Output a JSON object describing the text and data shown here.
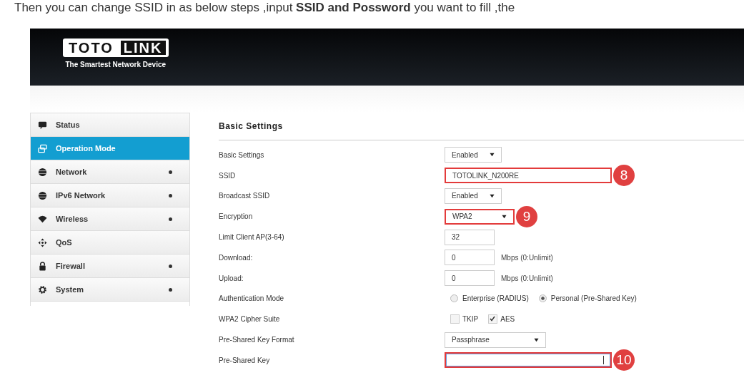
{
  "document_text": "Then you can change SSID in as below steps ,input **SSID and Possword** you want to fill ,the",
  "header": {
    "logo_left": "TOTO",
    "logo_right": "LINK",
    "tagline": "The Smartest Network Device"
  },
  "sidebar": {
    "items": [
      {
        "label": "Status",
        "kind": "chat",
        "selected": false,
        "expandable": false
      },
      {
        "label": "Operation Mode",
        "kind": "windows",
        "selected": true,
        "expandable": false
      },
      {
        "label": "Network",
        "kind": "globe",
        "selected": false,
        "expandable": true
      },
      {
        "label": "IPv6 Network",
        "kind": "globe",
        "selected": false,
        "expandable": true
      },
      {
        "label": "Wireless",
        "kind": "wifi",
        "selected": false,
        "expandable": true
      },
      {
        "label": "QoS",
        "kind": "arrows",
        "selected": false,
        "expandable": false
      },
      {
        "label": "Firewall",
        "kind": "lock",
        "selected": false,
        "expandable": true
      },
      {
        "label": "System",
        "kind": "gear",
        "selected": false,
        "expandable": true
      }
    ]
  },
  "section_title": "Basic Settings",
  "rows": [
    {
      "label": "Basic Settings",
      "kind": "select",
      "value": "Enabled",
      "highlighted": false
    },
    {
      "label": "SSID",
      "kind": "wide-text",
      "value": "TOTOLINK_N200RE",
      "highlighted": true,
      "step": "8"
    },
    {
      "label": "Broadcast SSID",
      "kind": "select",
      "value": "Enabled",
      "highlighted": false
    },
    {
      "label": "Encryption",
      "kind": "mid-select",
      "value": "WPA2",
      "highlighted": true,
      "step": "9"
    },
    {
      "label": "Limit Client AP(3-64)",
      "kind": "text",
      "value": "32",
      "highlighted": false
    },
    {
      "label": "Download:",
      "kind": "text",
      "value": "0",
      "unit": "Mbps (0:Unlimit)",
      "highlighted": false
    },
    {
      "label": "Upload:",
      "kind": "text",
      "value": "0",
      "unit": "Mbps (0:Unlimit)",
      "highlighted": false
    },
    {
      "label": "Authentication Mode",
      "kind": "radio",
      "options": [
        {
          "label": "Enterprise (RADIUS)",
          "selected": false
        },
        {
          "label": "Personal (Pre-Shared Key)",
          "selected": true
        }
      ]
    },
    {
      "label": "WPA2 Cipher Suite",
      "kind": "checkbox",
      "options": [
        {
          "label": "TKIP",
          "checked": false
        },
        {
          "label": "AES",
          "checked": true
        }
      ]
    },
    {
      "label": "Pre-Shared Key Format",
      "kind": "wide-select",
      "value": "Passphrase",
      "highlighted": false
    },
    {
      "label": "Pre-Shared Key",
      "kind": "wide-text",
      "value": "",
      "focused": true,
      "highlighted": true,
      "step": "10"
    }
  ]
}
